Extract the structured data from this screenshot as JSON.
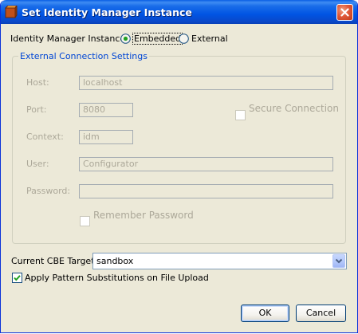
{
  "window": {
    "title": "Set Identity Manager Instance"
  },
  "instance": {
    "label": "Identity Manager Instance:",
    "options": [
      {
        "label": "Embedded",
        "selected": true
      },
      {
        "label": "External",
        "selected": false
      }
    ]
  },
  "external": {
    "legend": "External Connection Settings",
    "host": {
      "label": "Host:",
      "value": "localhost"
    },
    "port": {
      "label": "Port:",
      "value": "8080"
    },
    "context": {
      "label": "Context:",
      "value": "idm"
    },
    "user": {
      "label": "User:",
      "value": "Configurator"
    },
    "password": {
      "label": "Password:",
      "value": ""
    },
    "secure": {
      "label": "Secure Connection",
      "checked": false
    },
    "remember": {
      "label": "Remember Password",
      "checked": false
    }
  },
  "cbe": {
    "label": "Current CBE Target:",
    "value": "sandbox"
  },
  "pattern": {
    "label": "Apply Pattern Substitutions on File Upload",
    "checked": true
  },
  "buttons": {
    "ok": "OK",
    "cancel": "Cancel"
  },
  "colors": {
    "title_bar": "#0054e3",
    "accent": "#0046d5",
    "disabled_text": "#aca899",
    "face": "#ece9d8"
  }
}
